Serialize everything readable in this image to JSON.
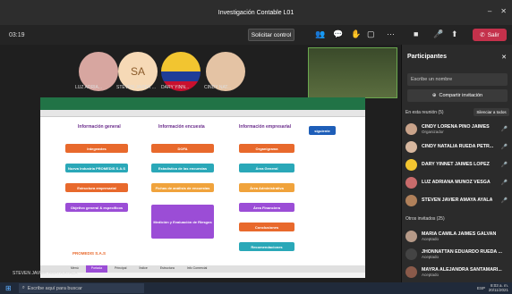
{
  "window": {
    "title": "Investigación Contable L01"
  },
  "toolbar": {
    "timer": "03:19",
    "control_button": "Solicitar control",
    "leave_button": "Salir"
  },
  "participants_tiles": [
    {
      "name": "LUZ ADRIA...",
      "initials": "",
      "color": "#d7a6a0"
    },
    {
      "name": "STEVEN JAVIER ...",
      "initials": "SA",
      "color": "#f6d9b6"
    },
    {
      "name": "DARY YINN...",
      "initials": "",
      "color": "#f2c530"
    },
    {
      "name": "CINDY NAT...",
      "initials": "",
      "color": "#e4c3a4"
    }
  ],
  "shared_sheet": {
    "headers": [
      "Información general",
      "Información encuesta",
      "Información empresarial"
    ],
    "col1": [
      "Integrantes",
      "Nueva Industria PROMEDIS S.A.S",
      "Estructura empresarial",
      "Objetivo general & específicos"
    ],
    "col2": [
      "DOFA",
      "Estadística de las encuestas",
      "Fichas de análisis de encuestas",
      "Medición y Evaluación de Riesgos"
    ],
    "col3": [
      "Organigrama",
      "Área General",
      "Área Administrativa",
      "Área Financiera",
      "Conclusiones",
      "Recomendaciones"
    ],
    "next_button": "siguiente",
    "logo_text": "PROMEDIS S.A.S",
    "tabs": [
      "Menú",
      "Portada",
      "Principal",
      "Índice",
      "Estructura",
      "Info Comercial"
    ]
  },
  "presenter_caption": "STEVEN JAVIER AMAYA AYALA",
  "panel": {
    "title": "Participantes",
    "search_placeholder": "Escribe un nombre",
    "invite_button": "Compartir invitación",
    "in_meeting_header": "En esta reunión (5)",
    "mute_all": "Silenciar a todos",
    "in_meeting": [
      {
        "name": "CINDY LORENA PINO JAIMES",
        "sub": "Organizador",
        "color": "#c9a38a"
      },
      {
        "name": "CINDY NATALIA RUEDA PETR...",
        "sub": "",
        "color": "#d7b79f"
      },
      {
        "name": "DARY YINNET JAIMES LOPEZ",
        "sub": "",
        "color": "#f2c530"
      },
      {
        "name": "LUZ ADRIANA MUÑOZ VESGA",
        "sub": "",
        "color": "#c96b6b"
      },
      {
        "name": "STEVEN JAVIER AMAYA AYALA",
        "sub": "",
        "color": "#b0805a"
      }
    ],
    "others_header": "Otros invitados (25)",
    "others": [
      {
        "name": "MARIA CAMILA JAIMES GALVAN",
        "sub": "Aceptado",
        "color": "#b69a88"
      },
      {
        "name": "JHONNATTAN EDUARDO RUEDA ...",
        "sub": "Aceptado",
        "color": "#444"
      },
      {
        "name": "MAYRA ALEJANDRA SANTAMARI...",
        "sub": "Aceptado",
        "color": "#8a5a4a"
      }
    ]
  },
  "taskbar": {
    "search_placeholder": "Escribe aquí para buscar",
    "time": "8:03 a. m.",
    "date": "20/11/2021",
    "lang": "ESP"
  }
}
